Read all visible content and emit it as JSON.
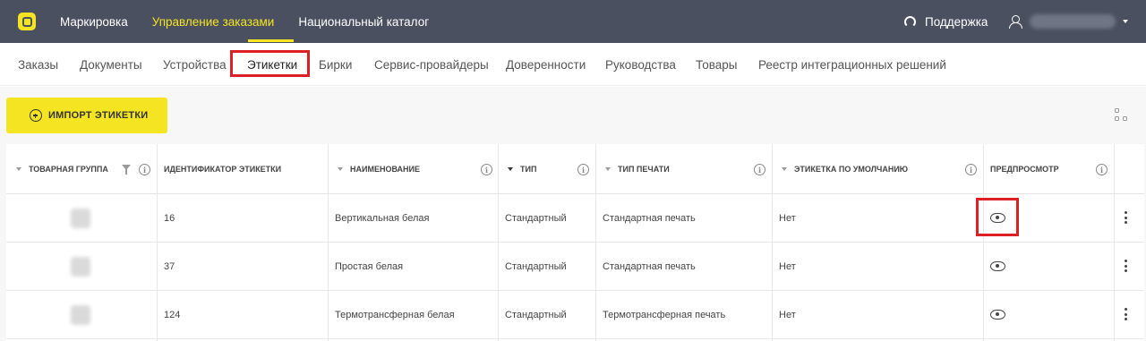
{
  "topbar": {
    "nav": [
      "Маркировка",
      "Управление заказами",
      "Национальный каталог"
    ],
    "active_index": 1,
    "support_label": "Поддержка"
  },
  "subnav": {
    "tabs": [
      "Заказы",
      "Документы",
      "Устройства",
      "Этикетки",
      "Бирки",
      "Сервис-провайдеры",
      "Доверенности",
      "Руководства",
      "Товары",
      "Реестр интеграционных решений"
    ],
    "active_index": 3
  },
  "toolbar": {
    "import_label": "ИМПОРТ ЭТИКЕТКИ"
  },
  "table": {
    "columns": [
      "ТОВАРНАЯ ГРУППА",
      "ИДЕНТИФИКАТОР ЭТИКЕТКИ",
      "НАИМЕНОВАНИЕ",
      "ТИП",
      "ТИП ПЕЧАТИ",
      "ЭТИКЕТКА ПО УМОЛЧАНИЮ",
      "ПРЕДПРОСМОТР"
    ],
    "info_glyph": "i",
    "rows": [
      {
        "id": "16",
        "name": "Вертикальная белая",
        "type": "Стандартный",
        "print_type": "Стандартная печать",
        "default": "Нет"
      },
      {
        "id": "37",
        "name": "Простая белая",
        "type": "Стандартный",
        "print_type": "Стандартная печать",
        "default": "Нет"
      },
      {
        "id": "124",
        "name": "Термотрансферная белая",
        "type": "Стандартный",
        "print_type": "Термотрансферная печать",
        "default": "Нет"
      }
    ]
  },
  "colors": {
    "topbar": "#4a5060",
    "accent": "#f5e422",
    "highlight": "#dd1f26"
  },
  "icons": [
    "logo-icon",
    "support-icon",
    "user-icon",
    "plus-circle-icon",
    "column-settings-icon",
    "filter-icon",
    "info-icon",
    "eye-icon",
    "more-vert-icon"
  ]
}
